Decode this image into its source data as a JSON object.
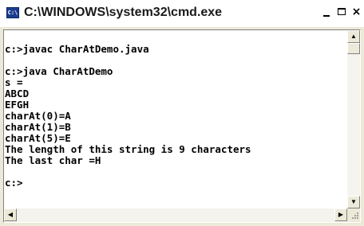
{
  "window": {
    "title": "C:\\WINDOWS\\system32\\cmd.exe",
    "icon": "cmd-icon",
    "icon_text": "C:\\",
    "controls": {
      "minimize": "minimize-icon",
      "maximize": "maximize-icon",
      "close": "×"
    }
  },
  "console": {
    "lines": [
      "",
      "c:>javac CharAtDemo.java",
      "",
      "c:>java CharAtDemo",
      "s =",
      "ABCD",
      "EFGH",
      "charAt(0)=A",
      "charAt(1)=B",
      "charAt(5)=E",
      "The length of this string is 9 characters",
      "The last char =H",
      "",
      "c:>"
    ]
  },
  "scrollbars": {
    "up": "▲",
    "down": "▼",
    "left": "◀",
    "right": "▶"
  },
  "colors": {
    "console_bg": "#ffffff",
    "console_fg": "#000000",
    "chrome": "#ece9d8"
  }
}
